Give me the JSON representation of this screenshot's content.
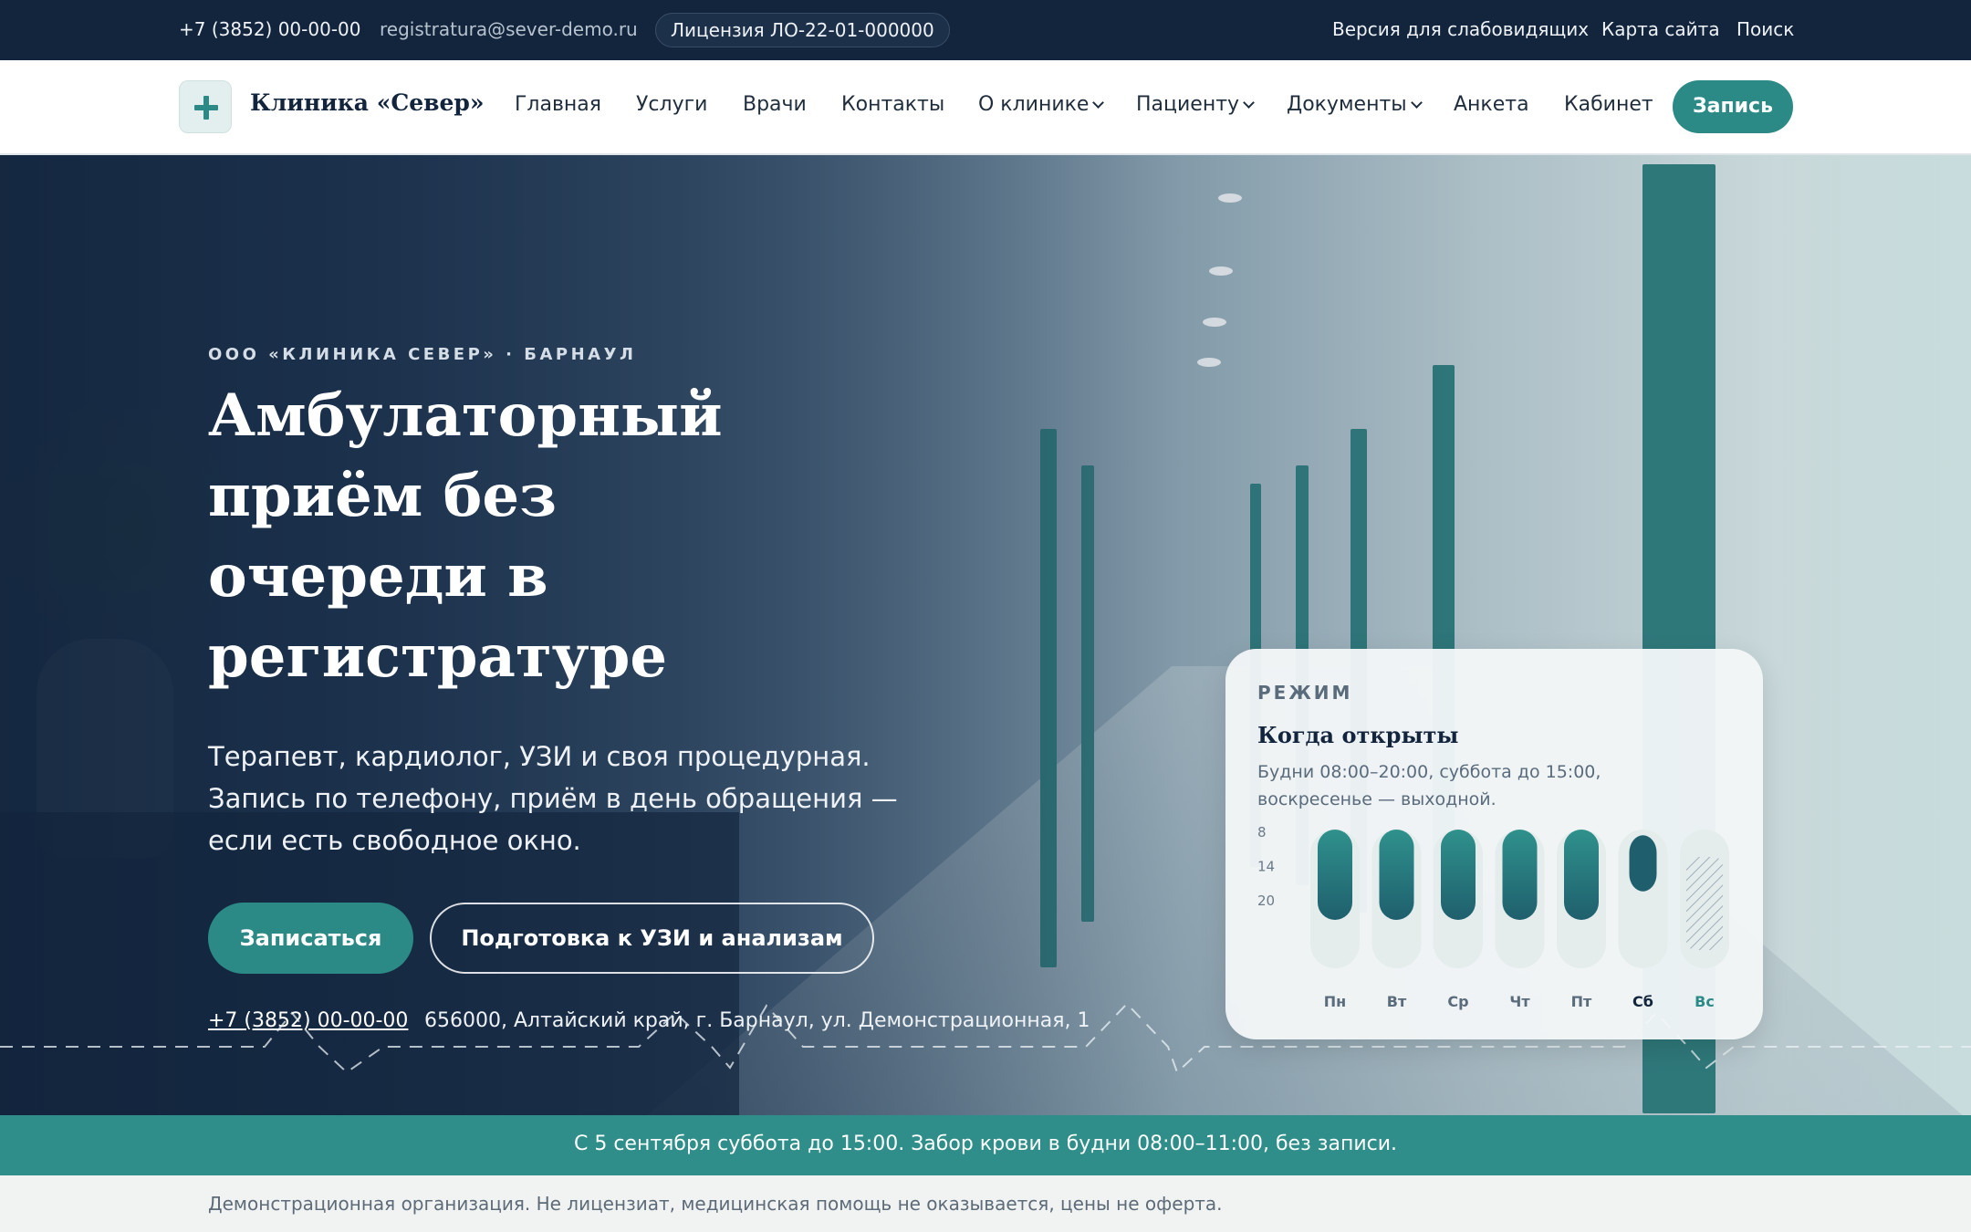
{
  "topbar": {
    "phone": "+7 (3852) 00-00-00",
    "email": "registratura@sever-demo.ru",
    "license": "Лицензия ЛО-22-01-000000",
    "low_vision": "Версия для слабовидящих",
    "sitemap": "Карта сайта",
    "search": "Поиск"
  },
  "nav": {
    "logo": "Клиника «Север»",
    "items": [
      "Главная",
      "Услуги",
      "Врачи",
      "Контакты",
      "О клинике",
      "Пациенту",
      "Документы",
      "Анкета",
      "Кабинет"
    ],
    "cta": "Запись"
  },
  "hero": {
    "eyebrow": "ООО «КЛИНИКА СЕВЕР» · БАРНАУЛ",
    "headline": "Амбулаторный приём без очереди в регистратуре",
    "lead": "Терапевт, кардиолог, УЗИ и своя процедурная. Запись по телефону, приём в день обращения — если есть свободное окно.",
    "btn_primary": "Записаться",
    "btn_secondary": "Подготовка к УЗИ и анализам",
    "phone": "+7 (3852) 00-00-00",
    "address": "656000, Алтайский край, г. Барнаул, ул. Демонстрационная, 1"
  },
  "schedule_card": {
    "kicker": "РЕЖИМ",
    "title": "Когда открыты",
    "description": "Будни 08:00–20:00, суббота до 15:00, воскресенье — выходной.",
    "axis_labels": [
      "8",
      "14",
      "20"
    ],
    "days": [
      {
        "label": "Пн",
        "open": 8,
        "close": 20
      },
      {
        "label": "Вт",
        "open": 8,
        "close": 20
      },
      {
        "label": "Ср",
        "open": 8,
        "close": 20
      },
      {
        "label": "Чт",
        "open": 8,
        "close": 20
      },
      {
        "label": "Пт",
        "open": 8,
        "close": 20
      },
      {
        "label": "Сб",
        "open": 9,
        "close": 15
      },
      {
        "label": "Вс",
        "open": null,
        "close": null
      }
    ],
    "accent_color": "#2b8a86",
    "sunday_color": "#2b8a86"
  },
  "announcement": "С 5 сентября суббота до 15:00. Забор крови в будни 08:00–11:00, без записи.",
  "disclaimer": "Демонстрационная организация. Не лицензиат, медицинская помощь не оказывается, цены не оферта.",
  "colors": {
    "topbar_bg": "#13253d",
    "accent": "#2b8a86",
    "announcement_bg": "#2f8e89"
  }
}
